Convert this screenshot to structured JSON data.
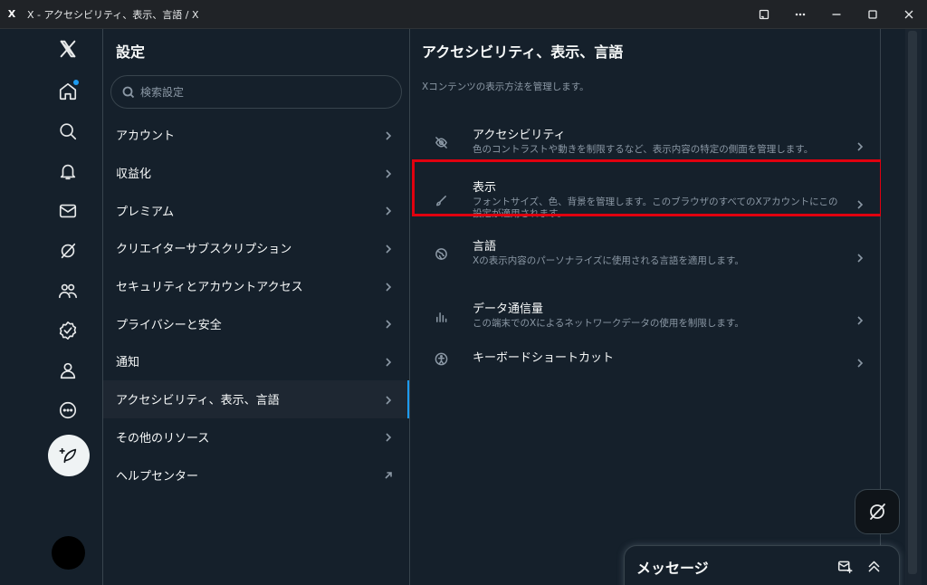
{
  "window": {
    "title": "X - アクセシビリティ、表示、言語 / X",
    "app_icon": "X"
  },
  "nav": {
    "icons": [
      "x-logo-icon",
      "home-icon",
      "search-icon",
      "bell-icon",
      "mail-icon",
      "grok-icon",
      "communities-icon",
      "verified-icon",
      "profile-icon",
      "more-icon",
      "compose-icon"
    ],
    "home_has_notification": true
  },
  "settings": {
    "title": "設定",
    "search_placeholder": "検索設定",
    "items": [
      {
        "label": "アカウント",
        "arrow": "chevron"
      },
      {
        "label": "収益化",
        "arrow": "chevron"
      },
      {
        "label": "プレミアム",
        "arrow": "chevron"
      },
      {
        "label": "クリエイターサブスクリプション",
        "arrow": "chevron"
      },
      {
        "label": "セキュリティとアカウントアクセス",
        "arrow": "chevron"
      },
      {
        "label": "プライバシーと安全",
        "arrow": "chevron"
      },
      {
        "label": "通知",
        "arrow": "chevron"
      },
      {
        "label": "アクセシビリティ、表示、言語",
        "arrow": "chevron",
        "active": true
      },
      {
        "label": "その他のリソース",
        "arrow": "chevron"
      },
      {
        "label": "ヘルプセンター",
        "arrow": "external"
      }
    ]
  },
  "detail": {
    "title": "アクセシビリティ、表示、言語",
    "description": "Xコンテンツの表示方法を管理します。",
    "items": [
      {
        "icon": "eye-off-icon",
        "label": "アクセシビリティ",
        "sub": "色のコントラストや動きを制限するなど、表示内容の特定の側面を管理します。"
      },
      {
        "icon": "brush-icon",
        "label": "表示",
        "sub": "フォントサイズ、色、背景を管理します。このブラウザのすべてのXアカウントにこの設定が適用されます。",
        "highlighted": true
      },
      {
        "icon": "globe-icon",
        "label": "言語",
        "sub": "Xの表示内容のパーソナライズに使用される言語を適用します。"
      },
      {
        "icon": "bar-chart-icon",
        "label": "データ通信量",
        "sub": "この端末でのXによるネットワークデータの使用を制限します。"
      },
      {
        "icon": "accessibility-icon",
        "label": "キーボードショートカット",
        "sub": ""
      }
    ]
  },
  "messages": {
    "title": "メッセージ"
  },
  "colors": {
    "background": "#15202b",
    "accent": "#1d9bf0",
    "highlight": "#e0000f"
  }
}
